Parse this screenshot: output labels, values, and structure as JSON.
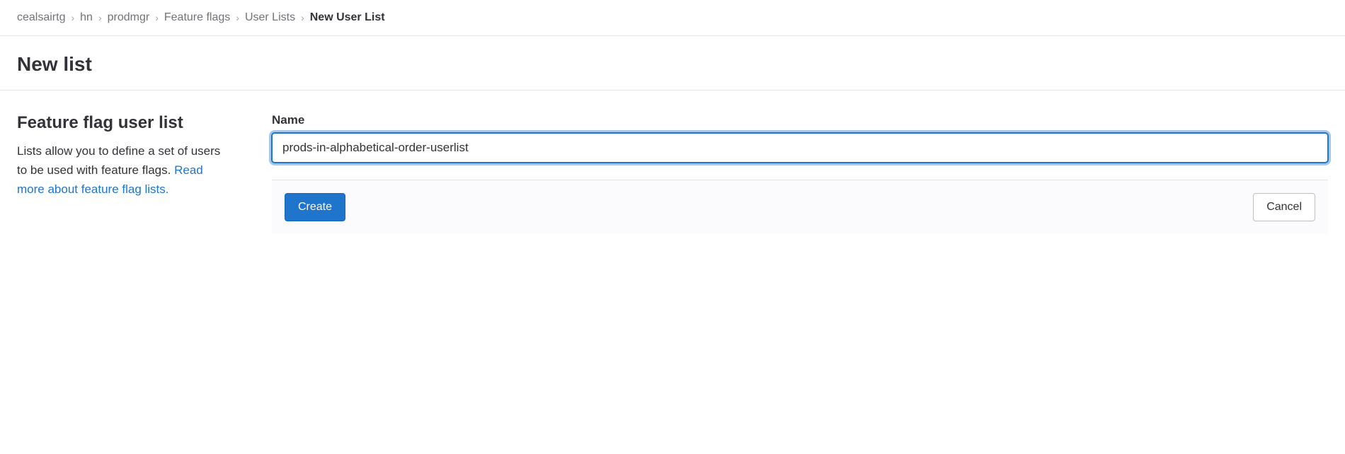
{
  "breadcrumb": {
    "items": [
      {
        "label": "cealsairtg"
      },
      {
        "label": "hn"
      },
      {
        "label": "prodmgr"
      },
      {
        "label": "Feature flags"
      },
      {
        "label": "User Lists"
      }
    ],
    "current": "New User List"
  },
  "page": {
    "title": "New list"
  },
  "sidebar": {
    "title": "Feature flag user list",
    "description_prefix": "Lists allow you to define a set of users to be used with feature flags. ",
    "link_text": "Read more about feature flag lists."
  },
  "form": {
    "name_label": "Name",
    "name_value": "prods-in-alphabetical-order-userlist",
    "create_label": "Create",
    "cancel_label": "Cancel"
  }
}
